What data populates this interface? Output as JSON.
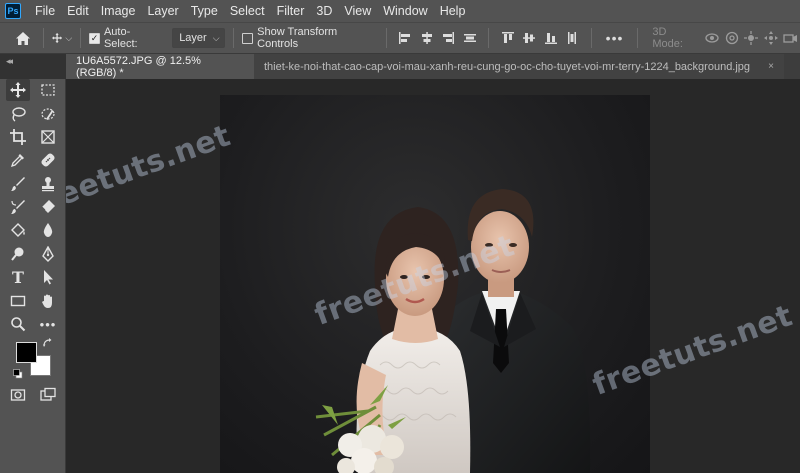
{
  "app": {
    "logo_text": "Ps"
  },
  "menu": [
    "File",
    "Edit",
    "Image",
    "Layer",
    "Type",
    "Select",
    "Filter",
    "3D",
    "View",
    "Window",
    "Help"
  ],
  "options": {
    "auto_select_label": "Auto-Select:",
    "auto_select_checked": true,
    "target_value": "Layer",
    "transform_label": "Show Transform Controls",
    "transform_checked": false,
    "more_label": "•••",
    "mode_label": "3D Mode:"
  },
  "tabs": [
    {
      "label": "1U6A5572.JPG @ 12.5% (RGB/8) *",
      "active": true
    },
    {
      "label": "thiet-ke-noi-that-cao-cap-voi-mau-xanh-reu-cung-go-oc-cho-tuyet-voi-mr-terry-1224_background.jpg",
      "close": "×",
      "active": false
    }
  ],
  "tools": [
    "move-tool",
    "marquee-tool",
    "lasso-tool",
    "quick-select-tool",
    "crop-tool",
    "frame-tool",
    "eyedropper-tool",
    "healing-tool",
    "brush-tool",
    "stamp-tool",
    "history-brush-tool",
    "eraser-tool",
    "paint-bucket-tool",
    "blur-tool",
    "dodge-tool",
    "pen-tool",
    "type-tool",
    "path-select-tool",
    "rectangle-tool",
    "hand-tool",
    "zoom-tool",
    "edit-toolbar"
  ],
  "tool_text": {
    "type": "T",
    "more": "•••"
  },
  "colors": {
    "foreground": "#000000",
    "background": "#ffffff",
    "ui_panel": "#535353",
    "workspace": "#282828"
  },
  "watermarks": [
    "freetuts.net",
    "freetuts.net",
    "freetuts.net"
  ]
}
